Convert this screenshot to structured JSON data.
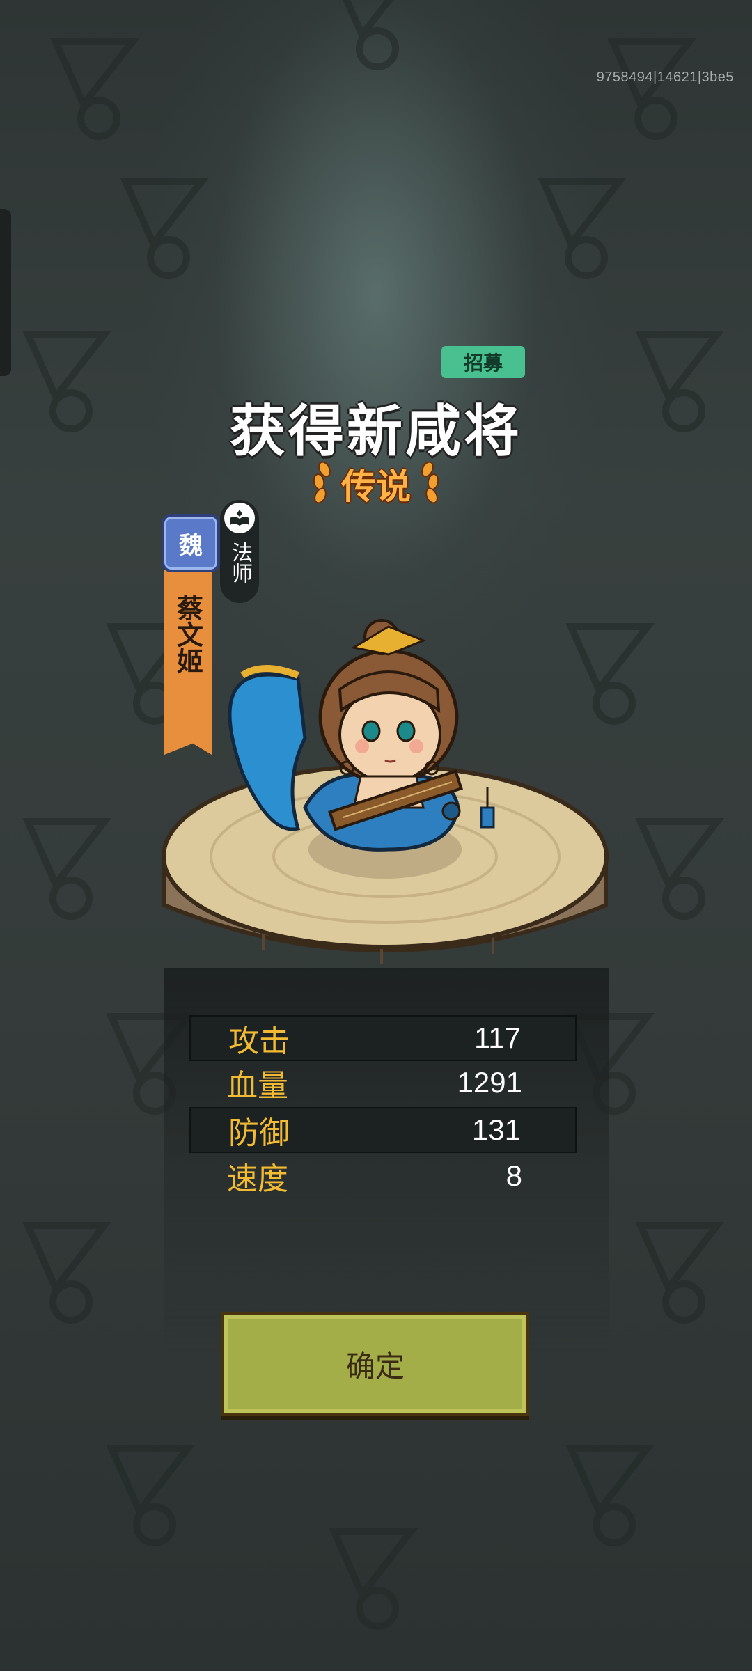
{
  "build_id": "9758494|14621|3be5",
  "recruit_badge": "招募",
  "title": "获得新咸将",
  "rarity": "传说",
  "hero": {
    "faction": "魏",
    "name": "蔡文姬",
    "class": "法师",
    "class_icon": "book-icon",
    "portrait": "guqin-player-character"
  },
  "stats": [
    {
      "label": "攻击",
      "value": "117"
    },
    {
      "label": "血量",
      "value": "1291"
    },
    {
      "label": "防御",
      "value": "131"
    },
    {
      "label": "速度",
      "value": "8"
    }
  ],
  "confirm_label": "确定",
  "colors": {
    "accent_gold": "#f3bb33",
    "rarity_orange": "#ffb347",
    "recruit_green": "#49c08f",
    "button_olive": "#a4ae48"
  }
}
